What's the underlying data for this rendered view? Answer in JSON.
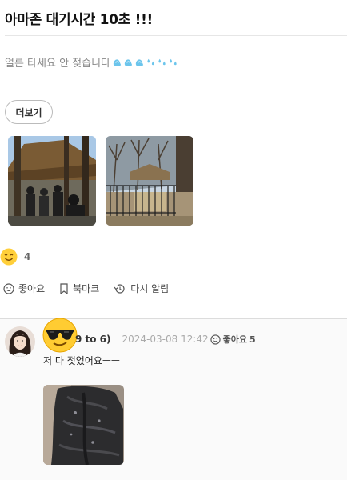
{
  "post": {
    "title": "아마존 대기시간 10초 !!!",
    "body": "얼른 타세요 안 젖습니다",
    "more_label": "더보기",
    "drop_icons": [
      "droplet-icon",
      "droplet-icon",
      "droplet-icon",
      "sweat-drops-icon",
      "sweat-drops-icon",
      "sweat-drops-icon"
    ],
    "images": [
      "crowd-photo",
      "zoo-photo"
    ]
  },
  "reactions": {
    "emoji": "smile-emoji-icon",
    "count": "4"
  },
  "actions": {
    "like_label": "좋아요",
    "bookmark_label": "북마크",
    "remind_label": "다시 알림"
  },
  "comment": {
    "author": "9 to 6)",
    "date": "2024-03-08 12:42",
    "like_label": "좋아요",
    "like_count": "5",
    "text": "저 다 젖었어요ㅡㅡ"
  },
  "colors": {
    "accent_yellow": "#ffcf3a",
    "drop_blue": "#6cc5ec",
    "divider": "#e6e6e6"
  }
}
